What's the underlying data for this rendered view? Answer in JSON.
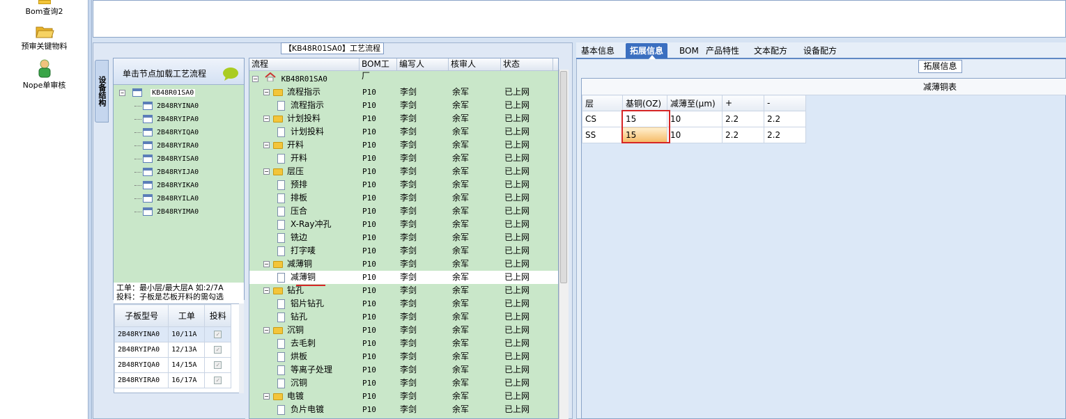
{
  "nav": {
    "items": [
      {
        "label": "Bom查询2",
        "icon": "folder-icon"
      },
      {
        "label": "预审关键物料",
        "icon": "open-folder-icon"
      },
      {
        "label": "Nope单审核",
        "icon": "user-icon"
      }
    ]
  },
  "left": {
    "header": "【KB48R01SA0】工艺流程",
    "sidetab": "设备结构",
    "tree_header": "单击节点加载工艺流程",
    "root": "KB48R01SA0",
    "children": [
      "2B48RYINA0",
      "2B48RYIPA0",
      "2B48RYIQA0",
      "2B48RYIRA0",
      "2B48RYISA0",
      "2B48RYIJA0",
      "2B48RYIKA0",
      "2B48RYILA0",
      "2B48RYIMA0"
    ],
    "note_line1": "工单：最小层/最大层A 如:2/7A",
    "note_line2": "投料：子板是芯板开料的需勾选",
    "sub_table": {
      "headers": [
        "子板型号",
        "工单",
        "投料"
      ],
      "rows": [
        {
          "model": "2B48RYINA0",
          "order": "10/11A",
          "checked": "✓"
        },
        {
          "model": "2B48RYIPA0",
          "order": "12/13A",
          "checked": "✓"
        },
        {
          "model": "2B48RYIQA0",
          "order": "14/15A",
          "checked": "✓"
        },
        {
          "model": "2B48RYIRA0",
          "order": "16/17A",
          "checked": "✓"
        }
      ]
    }
  },
  "flow": {
    "headers": [
      "流程",
      "BOM工厂",
      "编写人",
      "核审人",
      "状态"
    ],
    "root": "KB48R01SA0",
    "rows": [
      {
        "name": "流程指示",
        "type": "folder",
        "bom": "P10",
        "writer": "李剑",
        "reviewer": "余军",
        "status": "已上网"
      },
      {
        "name": "流程指示",
        "type": "doc",
        "bom": "P10",
        "writer": "李剑",
        "reviewer": "余军",
        "status": "已上网"
      },
      {
        "name": "计划投料",
        "type": "folder",
        "bom": "P10",
        "writer": "李剑",
        "reviewer": "余军",
        "status": "已上网"
      },
      {
        "name": "计划投料",
        "type": "doc",
        "bom": "P10",
        "writer": "李剑",
        "reviewer": "余军",
        "status": "已上网"
      },
      {
        "name": "开料",
        "type": "folder",
        "bom": "P10",
        "writer": "李剑",
        "reviewer": "余军",
        "status": "已上网"
      },
      {
        "name": "开料",
        "type": "doc",
        "bom": "P10",
        "writer": "李剑",
        "reviewer": "余军",
        "status": "已上网"
      },
      {
        "name": "层压",
        "type": "folder",
        "bom": "P10",
        "writer": "李剑",
        "reviewer": "余军",
        "status": "已上网"
      },
      {
        "name": "预排",
        "type": "doc",
        "bom": "P10",
        "writer": "李剑",
        "reviewer": "余军",
        "status": "已上网"
      },
      {
        "name": "排板",
        "type": "doc",
        "bom": "P10",
        "writer": "李剑",
        "reviewer": "余军",
        "status": "已上网"
      },
      {
        "name": "压合",
        "type": "doc",
        "bom": "P10",
        "writer": "李剑",
        "reviewer": "余军",
        "status": "已上网"
      },
      {
        "name": "X-Ray冲孔",
        "type": "doc",
        "bom": "P10",
        "writer": "李剑",
        "reviewer": "余军",
        "status": "已上网"
      },
      {
        "name": "铣边",
        "type": "doc",
        "bom": "P10",
        "writer": "李剑",
        "reviewer": "余军",
        "status": "已上网"
      },
      {
        "name": "打字唛",
        "type": "doc",
        "bom": "P10",
        "writer": "李剑",
        "reviewer": "余军",
        "status": "已上网"
      },
      {
        "name": "减薄铜",
        "type": "folder",
        "bom": "P10",
        "writer": "李剑",
        "reviewer": "余军",
        "status": "已上网"
      },
      {
        "name": "减薄铜",
        "type": "doc",
        "bom": "P10",
        "writer": "李剑",
        "reviewer": "余军",
        "status": "已上网"
      },
      {
        "name": "钻孔",
        "type": "folder",
        "bom": "P10",
        "writer": "李剑",
        "reviewer": "余军",
        "status": "已上网"
      },
      {
        "name": "铝片钻孔",
        "type": "doc",
        "bom": "P10",
        "writer": "李剑",
        "reviewer": "余军",
        "status": "已上网"
      },
      {
        "name": "钻孔",
        "type": "doc",
        "bom": "P10",
        "writer": "李剑",
        "reviewer": "余军",
        "status": "已上网"
      },
      {
        "name": "沉铜",
        "type": "folder",
        "bom": "P10",
        "writer": "李剑",
        "reviewer": "余军",
        "status": "已上网"
      },
      {
        "name": "去毛刺",
        "type": "doc",
        "bom": "P10",
        "writer": "李剑",
        "reviewer": "余军",
        "status": "已上网"
      },
      {
        "name": "烘板",
        "type": "doc",
        "bom": "P10",
        "writer": "李剑",
        "reviewer": "余军",
        "status": "已上网"
      },
      {
        "name": "等离子处理",
        "type": "doc",
        "bom": "P10",
        "writer": "李剑",
        "reviewer": "余军",
        "status": "已上网"
      },
      {
        "name": "沉铜",
        "type": "doc",
        "bom": "P10",
        "writer": "李剑",
        "reviewer": "余军",
        "status": "已上网"
      },
      {
        "name": "电镀",
        "type": "folder",
        "bom": "P10",
        "writer": "李剑",
        "reviewer": "余军",
        "status": "已上网"
      },
      {
        "name": "负片电镀",
        "type": "doc",
        "bom": "P10",
        "writer": "李剑",
        "reviewer": "余军",
        "status": "已上网"
      }
    ]
  },
  "right": {
    "tabs": [
      "基本信息",
      "拓展信息",
      "BOM",
      "产品特性",
      "文本配方",
      "设备配方"
    ],
    "active_tab": 1,
    "panel_label": "拓展信息",
    "table_title": "减薄铜表",
    "table": {
      "headers": [
        "层",
        "基铜(OZ)",
        "减薄至(μm)",
        "+",
        "-"
      ],
      "rows": [
        {
          "layer": "CS",
          "base": "15",
          "thin": "10",
          "plus": "2.2",
          "minus": "2.2"
        },
        {
          "layer": "SS",
          "base": "15",
          "thin": "10",
          "plus": "2.2",
          "minus": "2.2"
        }
      ]
    }
  }
}
